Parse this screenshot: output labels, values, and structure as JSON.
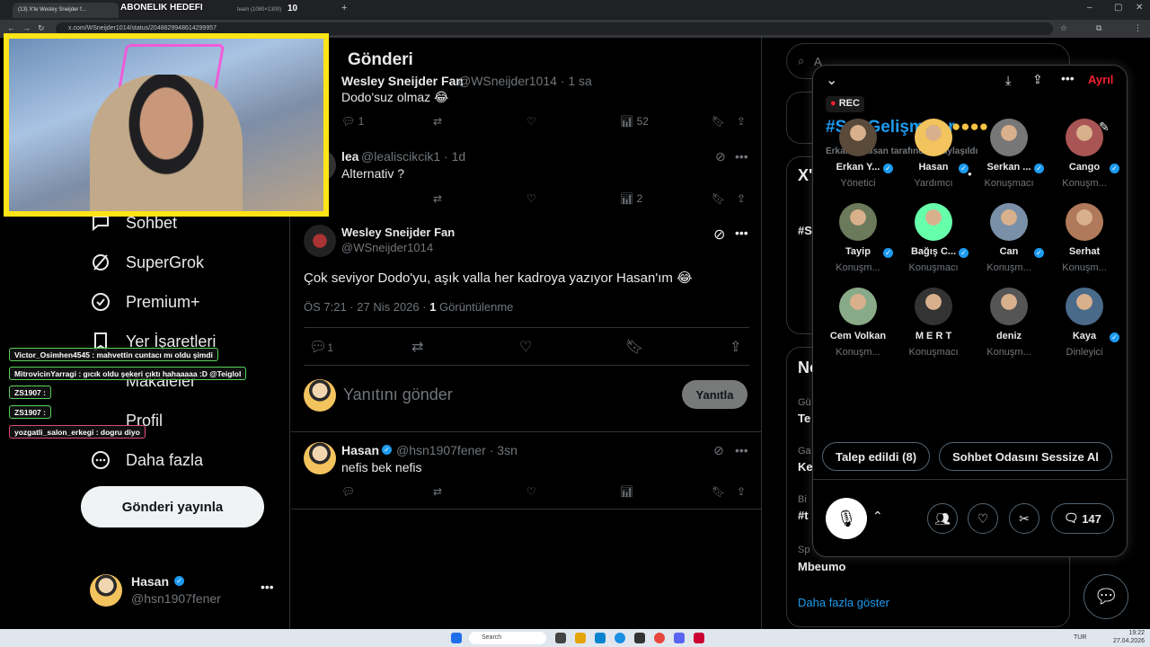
{
  "browser": {
    "tabs": [
      "(13) X'te Wesley Sneijder f...",
      "ABONELIK HEDEFI",
      "",
      "team (1080×1300)",
      "10"
    ],
    "url": "x.com/WSneijder1014/status/2048829948614299957",
    "stream_goal": "ABONELIK HEDEFI"
  },
  "nav": {
    "items": [
      "Sohbet",
      "SuperGrok",
      "Premium+",
      "Yer İşaretleri",
      "Makaleler",
      "Profil",
      "Daha fazla"
    ],
    "post_button": "Gönderi yayınla",
    "profile_name": "Hasan",
    "profile_handle": "@hsn1907fener"
  },
  "chat": [
    {
      "user": "Victor_Osimhen4545",
      "text": "Victor_Osimhen4545 : mahvettin cuntacı mı oldu şimdi"
    },
    {
      "user": "MitrovicinYarragi",
      "text": "MitrovicinYarragi : gıcık oldu şekeri çıktı hahaaaaa :D @Teiglol"
    },
    {
      "user": "ZS1907",
      "text": "ZS1907 :"
    },
    {
      "user": "ZS1907",
      "text": "ZS1907 :"
    },
    {
      "user": "yozgatli_salon_erkegi",
      "text": "yozgatli_salon_erkegi : dogru diyo"
    }
  ],
  "main": {
    "title": "Gönderi",
    "tweets": [
      {
        "name": "Wesley Sneijder Fan",
        "handle": "@WSneijder1014 · 1 sa",
        "text": "Dodo'suz olmaz 😂",
        "replies": "1",
        "likes": "",
        "views": "52"
      },
      {
        "name": "lea",
        "handle": "@lealiscikcik1 · 1d",
        "text": "Alternativ ?",
        "replies": "1",
        "likes": "",
        "views": "2"
      }
    ],
    "focus": {
      "name": "Wesley Sneijder Fan",
      "handle": "@WSneijder1014",
      "text": "Çok seviyor Dodo'yu, aşık valla her kadroya yazıyor Hasan'ım 😂",
      "time": "ÖS 7:21 · 27 Nis 2026 · ",
      "views_count": "1",
      "views_label": " Görüntülenme",
      "replies": "1"
    },
    "reply_placeholder": "Yanıtını gönder",
    "reply_button": "Yanıtla",
    "reply": {
      "name": "Hasan",
      "handle": "@hsn1907fener · 3sn",
      "text": "nefis bek nefis"
    }
  },
  "right": {
    "search_placeholder": "A",
    "partial_labels": [
      "X'",
      "#S",
      "No",
      "Gü",
      "Te",
      "Ga",
      "Ke",
      "Bi",
      "#t",
      "Sp"
    ],
    "trend": "Mbeumo",
    "show_more": "Daha fazla göster"
  },
  "spaces": {
    "leave": "Ayrıl",
    "rec": "REC",
    "title": "#SonGelişmeler",
    "host_line": "Erkan Yurusan tarafından paylaşıldı",
    "participants": [
      {
        "name": "Erkan Y...",
        "role": "Yönetici",
        "verified": true
      },
      {
        "name": "Hasan",
        "role": "Yardımcı",
        "verified": true
      },
      {
        "name": "Serkan ...",
        "role": "Konuşmacı",
        "verified": true
      },
      {
        "name": "Cango",
        "role": "Konuşm...",
        "verified": true
      },
      {
        "name": "Tayip",
        "role": "Konuşm...",
        "verified": true
      },
      {
        "name": "Bağış C...",
        "role": "Konuşmacı",
        "verified": true
      },
      {
        "name": "Can",
        "role": "Konuşm...",
        "verified": true
      },
      {
        "name": "Serhat",
        "role": "Konuşm...",
        "verified": false
      },
      {
        "name": "Cem Volkan",
        "role": "Konuşm...",
        "verified": false
      },
      {
        "name": "M E R T",
        "role": "Konuşmacı",
        "verified": false
      },
      {
        "name": "deniz",
        "role": "Konuşm...",
        "verified": false
      },
      {
        "name": "Kaya",
        "role": "Dinleyici",
        "verified": true
      }
    ],
    "requests_button": "Talep edildi (8)",
    "mute_button": "Sohbet Odasını Sessize Al",
    "comment_count": "147"
  },
  "taskbar": {
    "search": "Search",
    "lang": "TUR",
    "time": "19:22",
    "date": "27.04.2026"
  },
  "colors": {
    "accent": "#1d9bf0",
    "leave": "#f4212e",
    "webcam_border": "#ffe418"
  }
}
